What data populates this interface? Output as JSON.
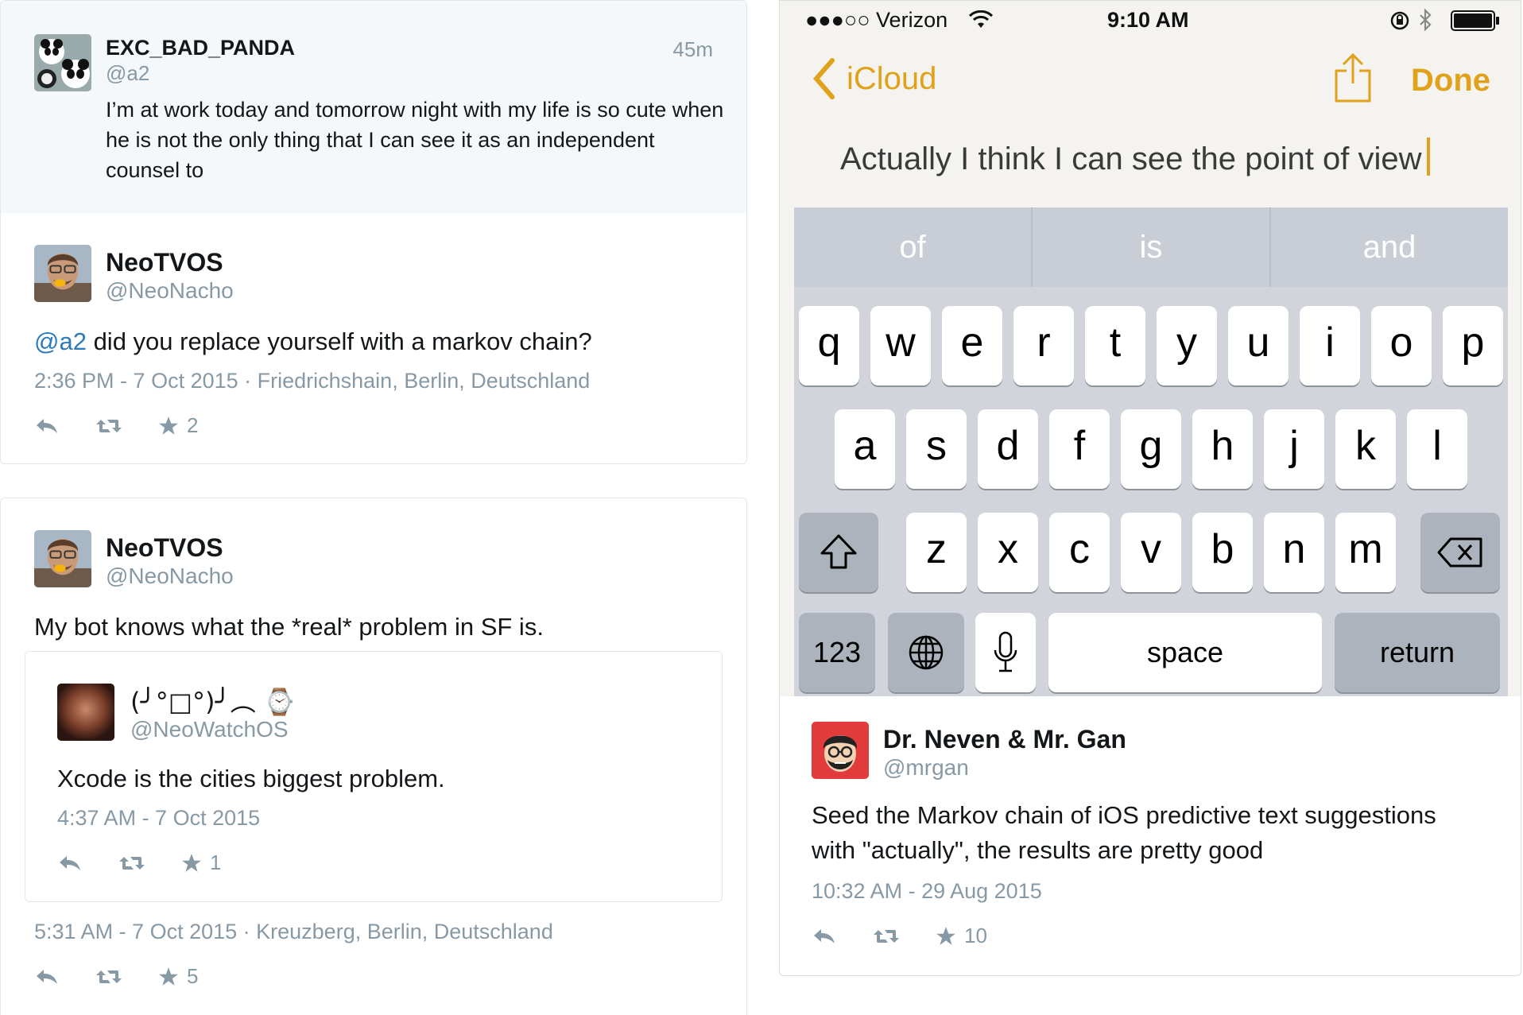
{
  "tweet1": {
    "name": "EXC_BAD_PANDA",
    "handle": "@a2",
    "time": "45m",
    "text": "I’m at work today and tomorrow night with my life is so cute when he is not the only thing that I can see it as an independent counsel to"
  },
  "tweet2": {
    "name": "NeoTVOS",
    "handle": "@NeoNacho",
    "mention": "@a2",
    "text": " did you replace yourself with a markov chain?",
    "meta": "2:36 PM - 7 Oct 2015 · Friedrichshain, Berlin, Deutschland",
    "favorites": "2"
  },
  "tweet3": {
    "name": "NeoTVOS",
    "handle": "@NeoNacho",
    "text": "My bot knows what the *real* problem in SF is.",
    "meta": "5:31 AM - 7 Oct 2015 · Kreuzberg, Berlin, Deutschland",
    "favorites": "5",
    "quoted": {
      "name": "(╯°□°)╯︵ ⌚",
      "handle": "@NeoWatchOS",
      "text": "Xcode is the cities biggest problem.",
      "meta": "4:37 AM - 7 Oct 2015",
      "favorites": "1"
    }
  },
  "phone": {
    "carrier": "●●●○○ Verizon",
    "time": "9:10 AM",
    "back_label": "iCloud",
    "done_label": "Done",
    "note_text": "Actually I think I can see the point of view",
    "accent": "#e0a11b",
    "predictions": [
      "of",
      "is",
      "and"
    ],
    "row1": [
      "q",
      "w",
      "e",
      "r",
      "t",
      "y",
      "u",
      "i",
      "o",
      "p"
    ],
    "row2": [
      "a",
      "s",
      "d",
      "f",
      "g",
      "h",
      "j",
      "k",
      "l"
    ],
    "row3": [
      "z",
      "x",
      "c",
      "v",
      "b",
      "n",
      "m"
    ],
    "key_123": "123",
    "key_space": "space",
    "key_return": "return"
  },
  "tweet4": {
    "name": "Dr. Neven & Mr. Gan",
    "handle": "@mrgan",
    "text": "Seed the Markov chain of iOS predictive text suggestions with \"actually\", the results are pretty good",
    "meta": "10:32 AM - 29 Aug 2015",
    "favorites": "10"
  },
  "icons": [
    "reply-icon",
    "retweet-icon",
    "star-icon",
    "share-icon",
    "wifi-icon",
    "bluetooth-icon",
    "battery-icon",
    "lock-rotation-icon",
    "shift-icon",
    "backspace-icon",
    "globe-icon",
    "microphone-icon"
  ],
  "colors": {
    "link": "#2b7bb9",
    "muted": "#8899a6",
    "highlight_bg": "#f5f8fa"
  }
}
